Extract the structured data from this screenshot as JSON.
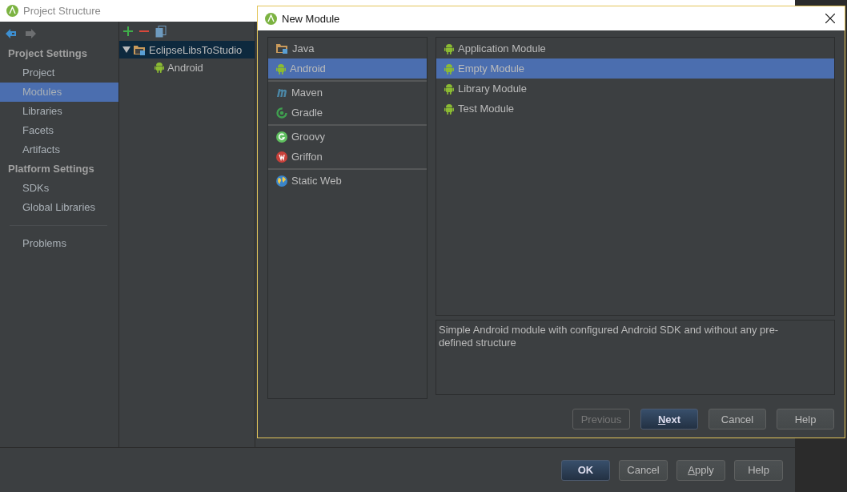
{
  "main_window": {
    "title": "Project Structure",
    "sidebar": {
      "sections": [
        {
          "heading": "Project Settings",
          "items": [
            {
              "label": "Project",
              "selected": false
            },
            {
              "label": "Modules",
              "selected": true
            },
            {
              "label": "Libraries",
              "selected": false
            },
            {
              "label": "Facets",
              "selected": false
            },
            {
              "label": "Artifacts",
              "selected": false
            }
          ]
        },
        {
          "heading": "Platform Settings",
          "items": [
            {
              "label": "SDKs",
              "selected": false
            },
            {
              "label": "Global Libraries",
              "selected": false
            }
          ]
        }
      ],
      "extra_items": [
        {
          "label": "Problems",
          "selected": false
        }
      ]
    },
    "tree": [
      {
        "label": "EclipseLibsToStudio",
        "kind": "module",
        "expanded": true,
        "selected": true,
        "children": [
          {
            "label": "Android",
            "kind": "android",
            "selected": false
          }
        ]
      }
    ],
    "buttons": [
      {
        "label": "OK",
        "default": true,
        "mnemonic": false,
        "disabled": false
      },
      {
        "label": "Cancel",
        "default": false,
        "mnemonic": false,
        "disabled": false
      },
      {
        "label": "Apply",
        "default": false,
        "mnemonic": true,
        "disabled": false
      },
      {
        "label": "Help",
        "default": false,
        "mnemonic": false,
        "disabled": false
      }
    ]
  },
  "dialog": {
    "title": "New Module",
    "categories": [
      {
        "items": [
          {
            "label": "Java",
            "kind": "folder",
            "selected": false
          },
          {
            "label": "Android",
            "kind": "android",
            "selected": true
          }
        ]
      },
      {
        "items": [
          {
            "label": "Maven",
            "kind": "maven",
            "selected": false
          },
          {
            "label": "Gradle",
            "kind": "gradle",
            "selected": false
          }
        ]
      },
      {
        "items": [
          {
            "label": "Groovy",
            "kind": "groovy",
            "selected": false
          },
          {
            "label": "Griffon",
            "kind": "griffon",
            "selected": false
          }
        ]
      },
      {
        "items": [
          {
            "label": "Static Web",
            "kind": "web",
            "selected": false
          }
        ]
      }
    ],
    "templates": [
      {
        "label": "Application Module",
        "selected": false
      },
      {
        "label": "Empty Module",
        "selected": true
      },
      {
        "label": "Library Module",
        "selected": false
      },
      {
        "label": "Test Module",
        "selected": false
      }
    ],
    "description": "Simple Android module with configured Android SDK and without any pre-defined structure",
    "buttons": [
      {
        "label": "Previous",
        "default": false,
        "mnemonic": false,
        "disabled": true
      },
      {
        "label": "Next",
        "default": true,
        "mnemonic": true,
        "disabled": false
      },
      {
        "label": "Cancel",
        "default": false,
        "mnemonic": false,
        "disabled": false
      },
      {
        "label": "Help",
        "default": false,
        "mnemonic": false,
        "disabled": false
      }
    ]
  }
}
